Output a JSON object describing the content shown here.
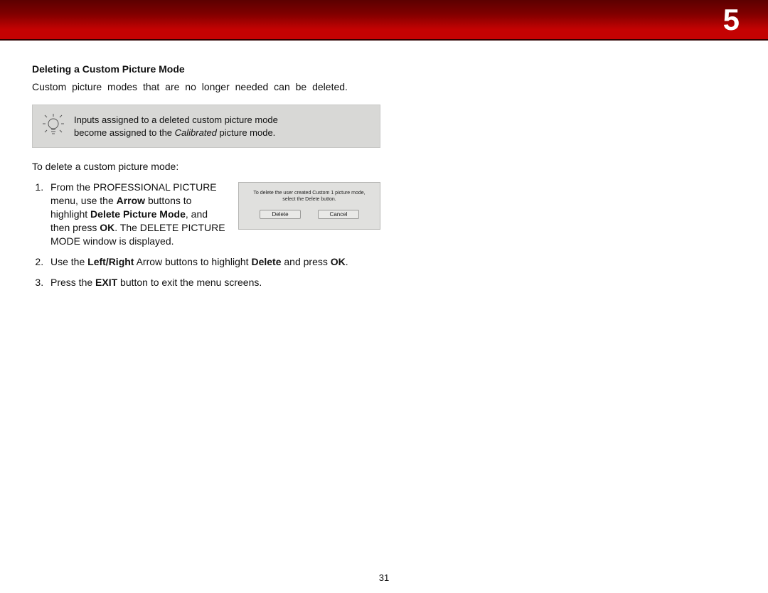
{
  "chapter": "5",
  "page_number": "31",
  "section_title": "Deleting a Custom Picture Mode",
  "intro": "Custom picture modes that are no longer needed can be deleted.",
  "tip_line1": "Inputs assigned to a deleted custom picture mode",
  "tip_line2a": "become assigned to the ",
  "tip_calibrated": "Calibrated",
  "tip_line2b": " picture mode.",
  "lead": "To delete a custom picture mode:",
  "step1_a": "From the PROFESSIONAL PICTURE menu, use the ",
  "step1_arrow": "Arrow",
  "step1_b": " buttons to highlight ",
  "step1_delpm": "Delete Picture Mode",
  "step1_c": ", and then press ",
  "step1_ok": "OK",
  "step1_d": ". The DELETE PICTURE MODE window is displayed.",
  "step2_a": "Use the ",
  "step2_lr": "Left/Right",
  "step2_b": " Arrow buttons to highlight ",
  "step2_del": "Delete",
  "step2_c": " and press ",
  "step2_ok": "OK",
  "step2_d": ".",
  "step3_a": "Press the ",
  "step3_exit": "EXIT",
  "step3_b": " button to exit the menu screens.",
  "dialog_msg1": "To delete the user created Custom 1 picture mode,",
  "dialog_msg2": "select the Delete button.",
  "dialog_btn_delete": "Delete",
  "dialog_btn_cancel": "Cancel"
}
